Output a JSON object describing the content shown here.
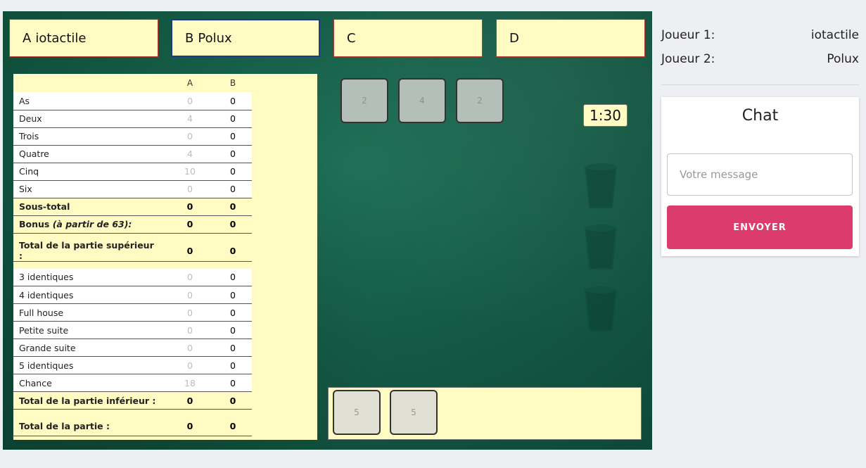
{
  "players": [
    {
      "letter": "A",
      "name": "iotactile"
    },
    {
      "letter": "B",
      "name": "Polux"
    },
    {
      "letter": "C",
      "name": ""
    },
    {
      "letter": "D",
      "name": ""
    }
  ],
  "scorecard": {
    "col_a": "A",
    "col_b": "B",
    "upper": [
      {
        "label": "As",
        "a": "0",
        "b": "0"
      },
      {
        "label": "Deux",
        "a": "4",
        "b": "0"
      },
      {
        "label": "Trois",
        "a": "0",
        "b": "0"
      },
      {
        "label": "Quatre",
        "a": "4",
        "b": "0"
      },
      {
        "label": "Cinq",
        "a": "10",
        "b": "0"
      },
      {
        "label": "Six",
        "a": "0",
        "b": "0"
      }
    ],
    "subtotal": {
      "label": "Sous-total",
      "a": "0",
      "b": "0"
    },
    "bonus": {
      "label": "Bonus",
      "note": "(à partir de 63):",
      "a": "0",
      "b": "0"
    },
    "upper_total": {
      "label": "Total de la partie supérieur :",
      "a": "0",
      "b": "0"
    },
    "lower": [
      {
        "label": "3 identiques",
        "a": "0",
        "b": "0"
      },
      {
        "label": "4 identiques",
        "a": "0",
        "b": "0"
      },
      {
        "label": "Full house",
        "a": "0",
        "b": "0"
      },
      {
        "label": "Petite suite",
        "a": "0",
        "b": "0"
      },
      {
        "label": "Grande suite",
        "a": "0",
        "b": "0"
      },
      {
        "label": "5 identiques",
        "a": "0",
        "b": "0"
      },
      {
        "label": "Chance",
        "a": "18",
        "b": "0"
      }
    ],
    "lower_total": {
      "label": "Total de la partie inférieur :",
      "a": "0",
      "b": "0"
    },
    "grand_total": {
      "label": "Total de la partie :",
      "a": "0",
      "b": "0"
    }
  },
  "dice_in_play": [
    "2",
    "4",
    "2"
  ],
  "dice_kept": [
    "5",
    "5"
  ],
  "timer": "1:30",
  "side": {
    "player1_label": "Joueur 1:",
    "player1_name": "iotactile",
    "player2_label": "Joueur 2:",
    "player2_name": "Polux"
  },
  "chat": {
    "title": "Chat",
    "placeholder": "Votre message",
    "send_label": "ENVOYER"
  },
  "colors": {
    "board": "#145a45",
    "card": "#fffbc2",
    "send_button": "#db3b6d",
    "active_border": "#1d3a8a",
    "player_border": "#c0392b"
  }
}
